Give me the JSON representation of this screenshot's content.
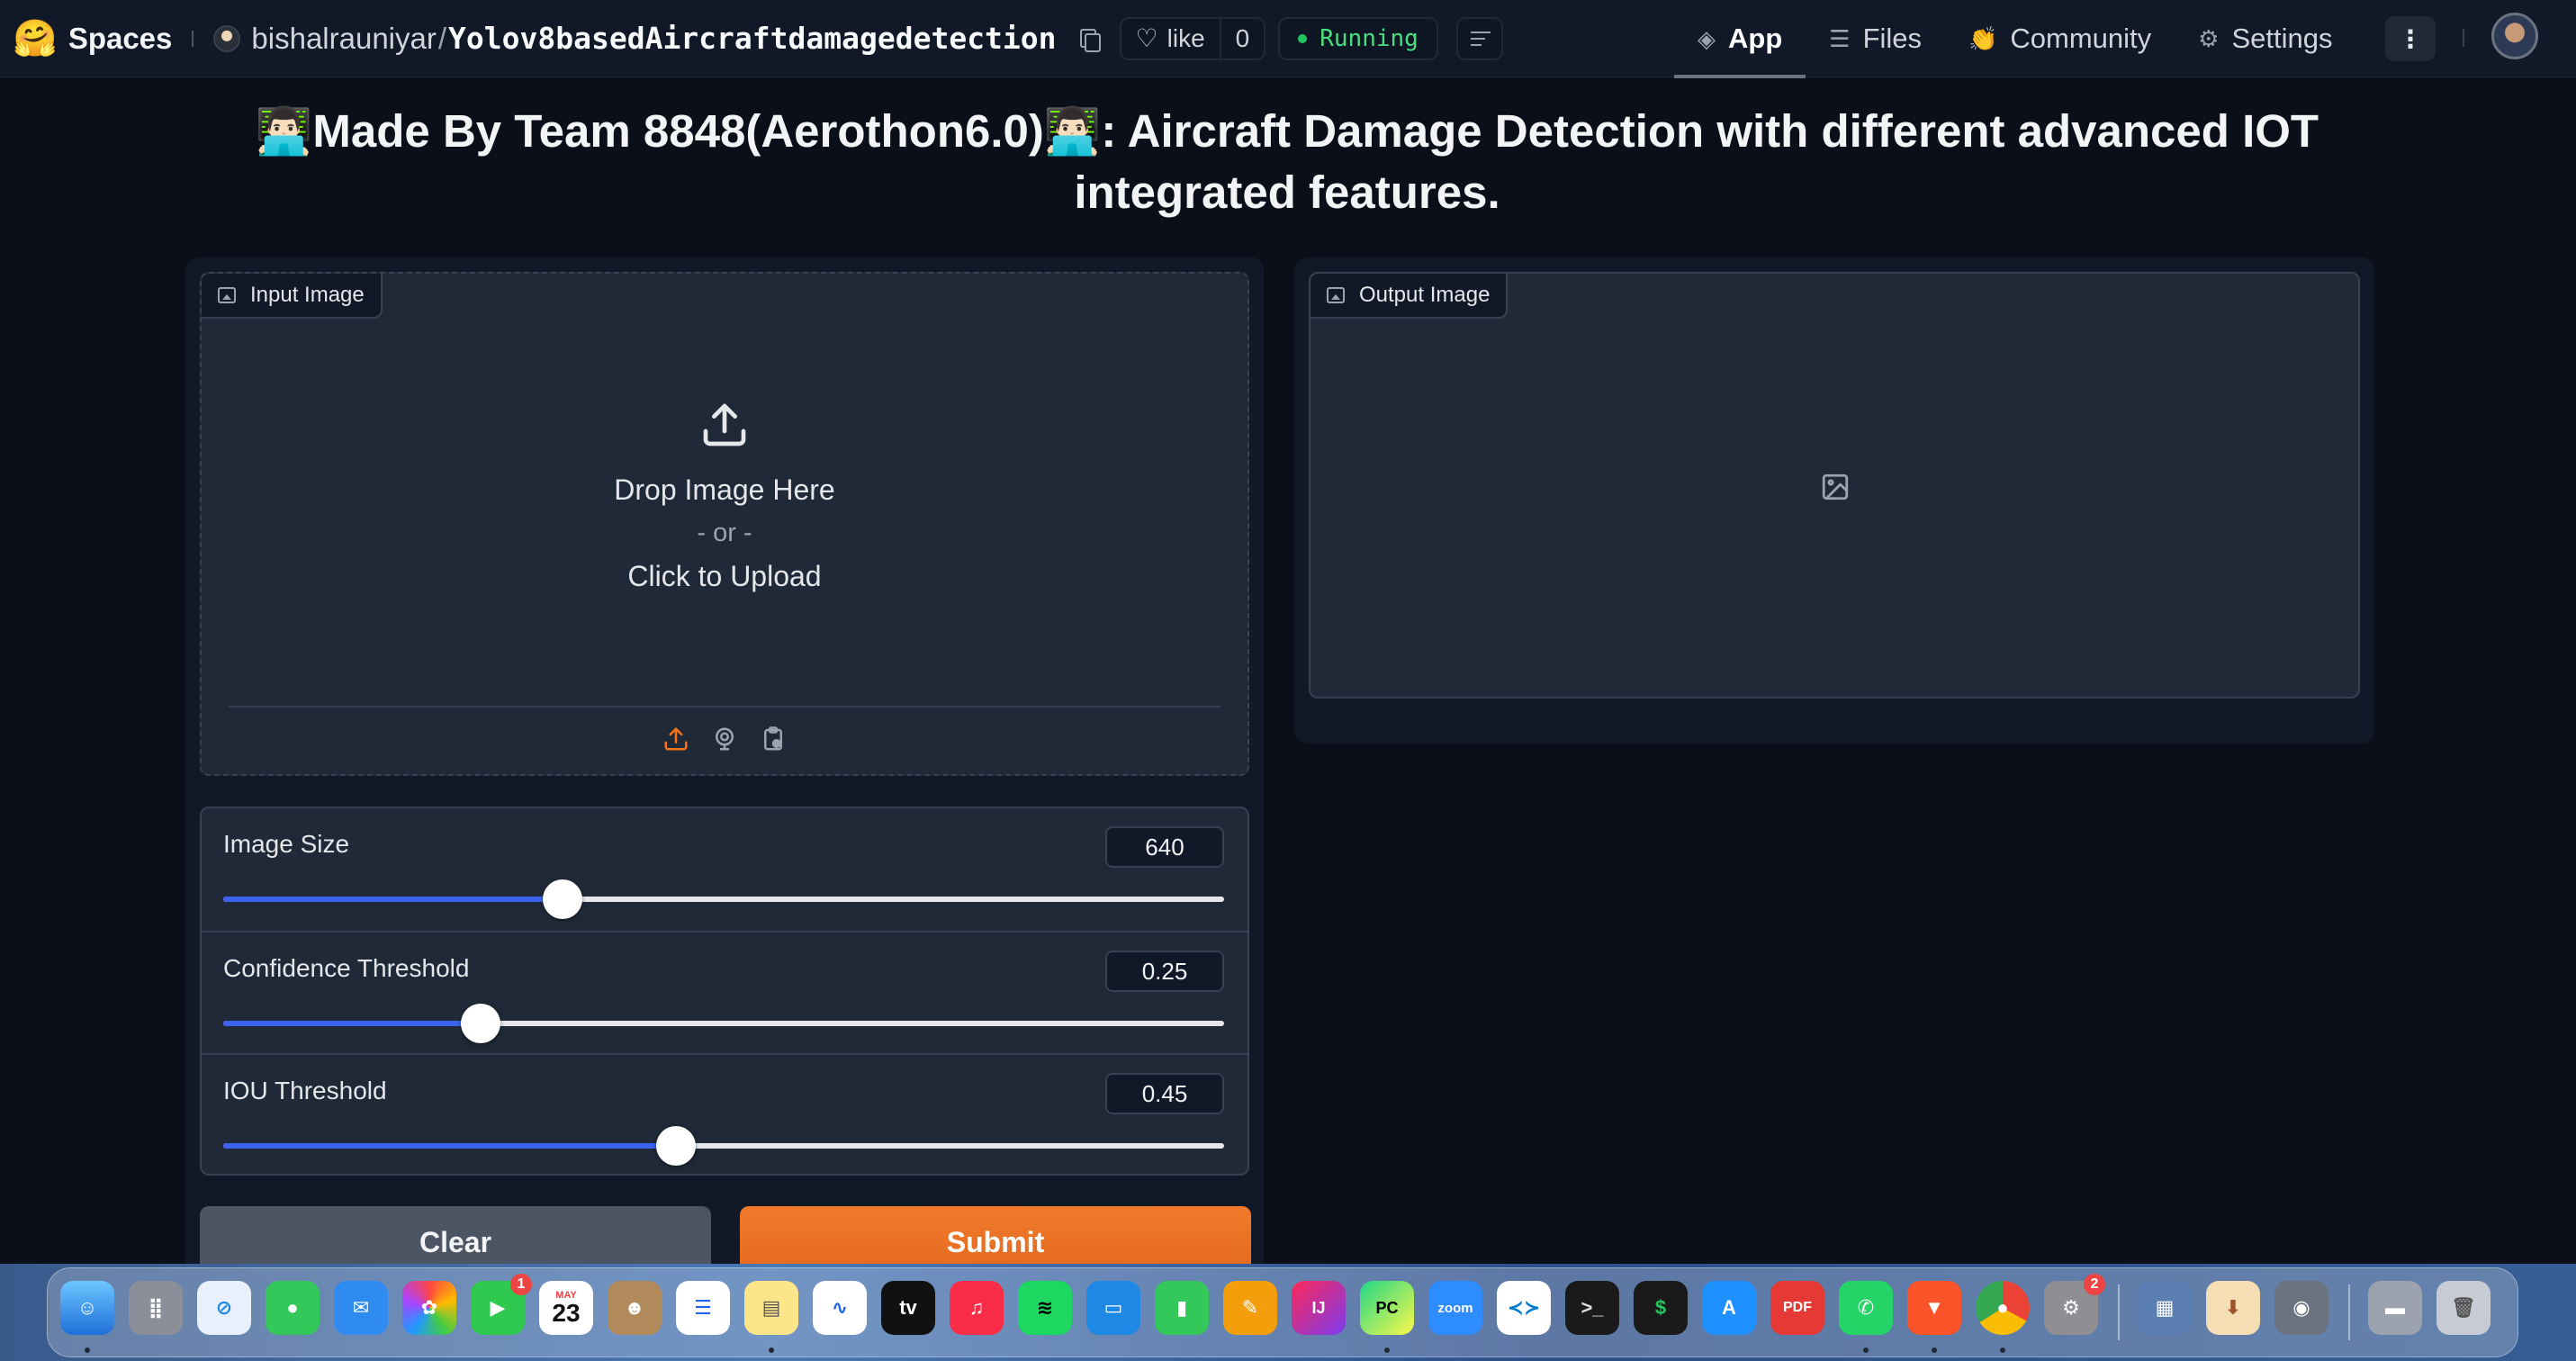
{
  "header": {
    "logo_emoji": "🤗",
    "brand": "Spaces",
    "owner": "bishalrauniyar",
    "slash": "/",
    "repo_name": "Yolov8basedAircraftdamagedetection",
    "like_label": "like",
    "like_count": "0",
    "status": "Running",
    "nav": [
      {
        "label": "App",
        "icon": "cube-icon",
        "active": true
      },
      {
        "label": "Files",
        "icon": "files-icon",
        "active": false
      },
      {
        "label": "Community",
        "icon": "community-icon",
        "active": false
      },
      {
        "label": "Settings",
        "icon": "gear-icon",
        "active": false
      }
    ]
  },
  "title": {
    "emoji": "👨🏻‍💻",
    "text_part1": "Made By Team 8848(Aerothon6.0)",
    "text_part2": ": Aircraft Damage Detection with different advanced IOT integrated features."
  },
  "input": {
    "label": "Input Image",
    "drop_text": "Drop Image Here",
    "or_text": "- or -",
    "click_text": "Click to Upload"
  },
  "output": {
    "label": "Output Image"
  },
  "sliders": [
    {
      "label": "Image Size",
      "value": "640",
      "fraction": 0.339
    },
    {
      "label": "Confidence Threshold",
      "value": "0.25",
      "fraction": 0.257
    },
    {
      "label": "IOU Threshold",
      "value": "0.45",
      "fraction": 0.452
    }
  ],
  "buttons": {
    "clear": "Clear",
    "submit": "Submit"
  },
  "dock": {
    "calendar_month": "MAY",
    "calendar_day": "23",
    "facetime_badge": "1",
    "settings_badge": "2",
    "tv_label": "tv",
    "zoom_label": "zoom",
    "intellij_label": "IJ",
    "pycharm_label": "PC",
    "pdf_label": "PDF"
  },
  "colors": {
    "background": "#0b0f19",
    "panel": "#111827",
    "accent_slider": "#3b63f0",
    "submit": "#e8711f",
    "status_green": "#4ade80"
  }
}
